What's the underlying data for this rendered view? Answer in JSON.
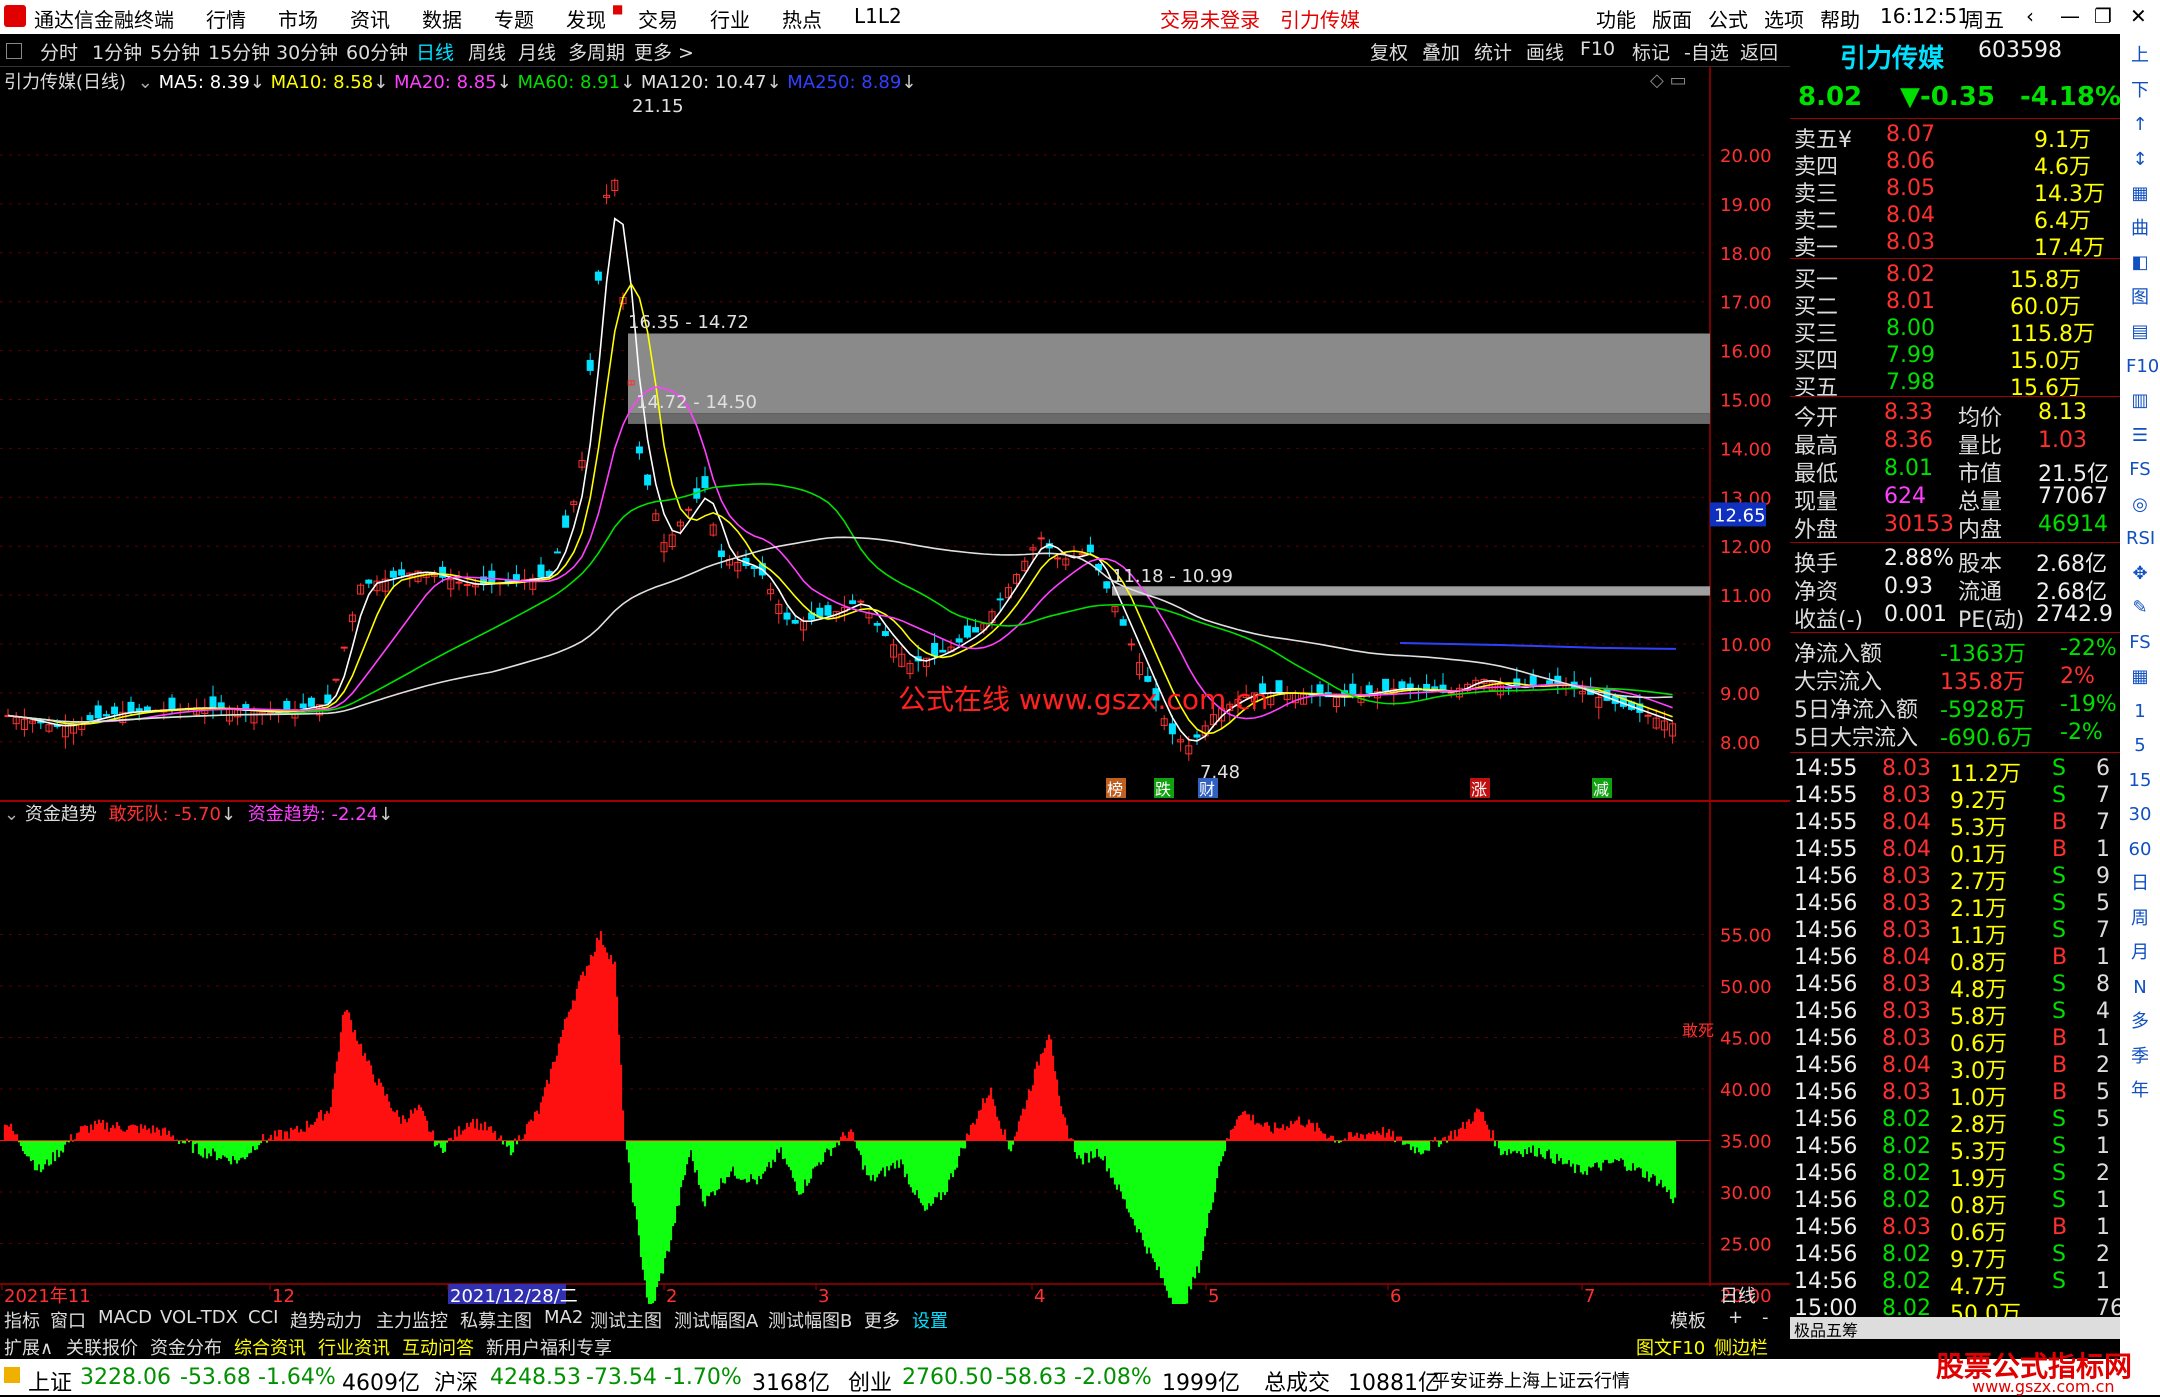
{
  "titlebar": {
    "app_name": "通达信金融终端",
    "menu": [
      "行情",
      "市场",
      "资讯",
      "数据",
      "专题",
      "发现",
      "交易",
      "行业",
      "热点",
      "L1L2"
    ],
    "status_login": "交易未登录",
    "stock_title": "引力传媒",
    "right_menu": [
      "功能",
      "版面",
      "公式",
      "选项",
      "帮助"
    ],
    "time": "16:12:51",
    "weekday": "周五"
  },
  "toolbar": {
    "periods": [
      "分时",
      "1分钟",
      "5分钟",
      "15分钟",
      "30分钟",
      "60分钟",
      "日线",
      "周线",
      "月线",
      "多周期",
      "更多 >"
    ],
    "selected": "日线",
    "right_tools": [
      "复权",
      "叠加",
      "统计",
      "画线",
      "F10",
      "标记",
      "-自选",
      "返回"
    ]
  },
  "chart": {
    "header_name": "引力传媒(日线)",
    "ma_labels": [
      {
        "text": "MA5: 8.39",
        "color": "#ffffff"
      },
      {
        "text": "MA10: 8.58",
        "color": "#ffff00"
      },
      {
        "text": "MA20: 8.85",
        "color": "#ff40ff"
      },
      {
        "text": "MA60: 8.91",
        "color": "#00e000"
      },
      {
        "text": "MA120: 10.47",
        "color": "#e0e0e0"
      },
      {
        "text": "MA250: 8.89",
        "color": "#3040ff"
      }
    ],
    "high_label": "21.15",
    "low_label": "7.48",
    "zone1_label": "16.35 - 14.72",
    "zone2_label": "14.72 - 14.50",
    "zone3_label": "11.18 - 10.99",
    "current_price_tag": "12.65",
    "y_axis": [
      "20.00",
      "19.00",
      "18.00",
      "17.00",
      "16.00",
      "15.00",
      "14.00",
      "13.00",
      "12.00",
      "11.00",
      "10.00",
      "9.00",
      "8.00"
    ],
    "watermark": "公式在线  www.gszx.com.cn",
    "event_marks": [
      "榜",
      "跌",
      "财",
      "涨",
      "减"
    ],
    "indicator_name": "资金趋势",
    "indicator_line1": "敢死队: -5.70",
    "indicator_line2": "资金趋势: -2.24",
    "indicator_y_axis": [
      "55.00",
      "50.00",
      "45.00",
      "40.00",
      "35.00",
      "30.00",
      "25.00",
      "20.00",
      "15.00"
    ],
    "indicator_side_label": "敢死",
    "x_axis": [
      "2021年11",
      "12",
      "2021/12/28/二",
      "2",
      "3",
      "4",
      "5",
      "6",
      "7"
    ],
    "x_axis_right": "日线"
  },
  "bottom_tabs": [
    "指标",
    "窗口",
    "MACD",
    "VOL-TDX",
    "CCI",
    "趋势动力",
    "主力监控",
    "私募主图",
    "MA2",
    "测试主图",
    "测试幅图A",
    "测试幅图B",
    "更多",
    "设置"
  ],
  "bottom_tabs_right": [
    "模板",
    "+",
    "-"
  ],
  "bottom_tabs2": [
    {
      "label": "扩展∧",
      "color": "#dddddd"
    },
    {
      "label": "关联报价",
      "color": "#dddddd"
    },
    {
      "label": "资金分布",
      "color": "#dddddd"
    },
    {
      "label": "综合资讯",
      "color": "#ffff00"
    },
    {
      "label": "行业资讯",
      "color": "#ffff00"
    },
    {
      "label": "互动问答",
      "color": "#ffff00"
    },
    {
      "label": "新用户福利专享",
      "color": "#dddddd"
    }
  ],
  "bottom_tabs2_right": [
    "图文F10",
    "侧边栏"
  ],
  "quote": {
    "name": "引力传媒",
    "code": "603598",
    "price": "8.02",
    "change": "▼-0.35",
    "pct": "-4.18%",
    "asks": [
      {
        "label": "卖五¥",
        "price": "8.07",
        "vol": "9.1万"
      },
      {
        "label": "卖四",
        "price": "8.06",
        "vol": "4.6万"
      },
      {
        "label": "卖三",
        "price": "8.05",
        "vol": "14.3万"
      },
      {
        "label": "卖二",
        "price": "8.04",
        "vol": "6.4万"
      },
      {
        "label": "卖一",
        "price": "8.03",
        "vol": "17.4万"
      }
    ],
    "bids": [
      {
        "label": "买一",
        "price": "8.02",
        "vol": "15.8万"
      },
      {
        "label": "买二",
        "price": "8.01",
        "vol": "60.0万"
      },
      {
        "label": "买三",
        "price": "8.00",
        "vol": "115.8万"
      },
      {
        "label": "买四",
        "price": "7.99",
        "vol": "15.0万"
      },
      {
        "label": "买五",
        "price": "7.98",
        "vol": "15.6万"
      }
    ],
    "stats": [
      {
        "l1": "今开",
        "v1": "8.33",
        "c1": "#ff3030",
        "l2": "均价",
        "v2": "8.13",
        "c2": "#ffff00"
      },
      {
        "l1": "最高",
        "v1": "8.36",
        "c1": "#ff3030",
        "l2": "量比",
        "v2": "1.03",
        "c2": "#ff3030"
      },
      {
        "l1": "最低",
        "v1": "8.01",
        "c1": "#00e000",
        "l2": "市值",
        "v2": "21.5亿",
        "c2": "#f0f0f0"
      },
      {
        "l1": "现量",
        "v1": "624",
        "c1": "#ff40ff",
        "l2": "总量",
        "v2": "77067",
        "c2": "#f0f0f0"
      },
      {
        "l1": "外盘",
        "v1": "30153",
        "c1": "#ff3030",
        "l2": "内盘",
        "v2": "46914",
        "c2": "#00e000"
      }
    ],
    "stats2": [
      {
        "l1": "换手",
        "v1": "2.88%",
        "l2": "股本",
        "v2": "2.68亿"
      },
      {
        "l1": "净资",
        "v1": "0.93",
        "l2": "流通",
        "v2": "2.68亿"
      },
      {
        "l1": "收益(-)",
        "v1": "0.001",
        "l2": "PE(动)",
        "v2": "2742.9"
      }
    ],
    "flows": [
      {
        "label": "净流入额",
        "val": "-1363万",
        "pct": "-22%",
        "color": "#00e000"
      },
      {
        "label": "大宗流入",
        "val": "135.8万",
        "pct": "2%",
        "color": "#ff3030"
      },
      {
        "label": "5日净流入额",
        "val": "-5928万",
        "pct": "-19%",
        "color": "#00e000"
      },
      {
        "label": "5日大宗流入",
        "val": "-690.6万",
        "pct": "-2%",
        "color": "#00e000"
      }
    ],
    "ticks": [
      {
        "t": "14:55",
        "p": "8.03",
        "v": "11.2万",
        "s": "S",
        "n": "6"
      },
      {
        "t": "14:55",
        "p": "8.03",
        "v": "9.2万",
        "s": "S",
        "n": "7"
      },
      {
        "t": "14:55",
        "p": "8.04",
        "v": "5.3万",
        "s": "B",
        "n": "7"
      },
      {
        "t": "14:55",
        "p": "8.04",
        "v": "0.1万",
        "s": "B",
        "n": "1"
      },
      {
        "t": "14:56",
        "p": "8.03",
        "v": "2.7万",
        "s": "S",
        "n": "9"
      },
      {
        "t": "14:56",
        "p": "8.03",
        "v": "2.1万",
        "s": "S",
        "n": "5"
      },
      {
        "t": "14:56",
        "p": "8.03",
        "v": "1.1万",
        "s": "S",
        "n": "7"
      },
      {
        "t": "14:56",
        "p": "8.04",
        "v": "0.8万",
        "s": "B",
        "n": "1"
      },
      {
        "t": "14:56",
        "p": "8.03",
        "v": "4.8万",
        "s": "S",
        "n": "8"
      },
      {
        "t": "14:56",
        "p": "8.03",
        "v": "5.8万",
        "s": "S",
        "n": "4"
      },
      {
        "t": "14:56",
        "p": "8.03",
        "v": "0.6万",
        "s": "B",
        "n": "1"
      },
      {
        "t": "14:56",
        "p": "8.04",
        "v": "3.0万",
        "s": "B",
        "n": "2"
      },
      {
        "t": "14:56",
        "p": "8.03",
        "v": "1.0万",
        "s": "B",
        "n": "5"
      },
      {
        "t": "14:56",
        "p": "8.02",
        "v": "2.8万",
        "s": "S",
        "n": "5"
      },
      {
        "t": "14:56",
        "p": "8.02",
        "v": "5.3万",
        "s": "S",
        "n": "1"
      },
      {
        "t": "14:56",
        "p": "8.02",
        "v": "1.9万",
        "s": "S",
        "n": "2"
      },
      {
        "t": "14:56",
        "p": "8.02",
        "v": "0.8万",
        "s": "S",
        "n": "1"
      },
      {
        "t": "14:56",
        "p": "8.03",
        "v": "0.6万",
        "s": "B",
        "n": "1"
      },
      {
        "t": "14:56",
        "p": "8.02",
        "v": "9.7万",
        "s": "S",
        "n": "2"
      },
      {
        "t": "14:56",
        "p": "8.02",
        "v": "4.7万",
        "s": "S",
        "n": "1"
      },
      {
        "t": "15:00",
        "p": "8.02",
        "v": "50.0万",
        "s": "",
        "n": "76"
      }
    ],
    "tab_mini": "极品五筹"
  },
  "sideicons": [
    "上",
    "下",
    "↑",
    "↕",
    "▦",
    "曲",
    "◧",
    "图",
    "▤",
    "F10",
    "▥",
    "☰",
    "FS",
    "◎",
    "RSI",
    "✥",
    "✎",
    "FS",
    "▦",
    "1",
    "5",
    "15",
    "30",
    "60",
    "日",
    "周",
    "月",
    "N",
    "多",
    "季",
    "年"
  ],
  "status": {
    "items": [
      {
        "name": "上证",
        "val": "3228.06",
        "chg": "-53.68",
        "pct": "-1.64%",
        "amt": "4609亿"
      },
      {
        "name": "沪深",
        "val": "4248.53",
        "chg": "-73.54",
        "pct": "-1.70%",
        "amt": "3168亿"
      },
      {
        "name": "创业",
        "val": "2760.50",
        "chg": "-58.63",
        "pct": "-2.08%",
        "amt": "1999亿"
      }
    ],
    "total_label": "总成交",
    "total_val": "10881亿",
    "broker": "平安证券上海上证云行情",
    "logo_text": "股票公式指标网",
    "logo_url": "www.gszx.com.cn"
  },
  "colors": {
    "up": "#ff3030",
    "down": "#00e000",
    "background": "#000000"
  }
}
